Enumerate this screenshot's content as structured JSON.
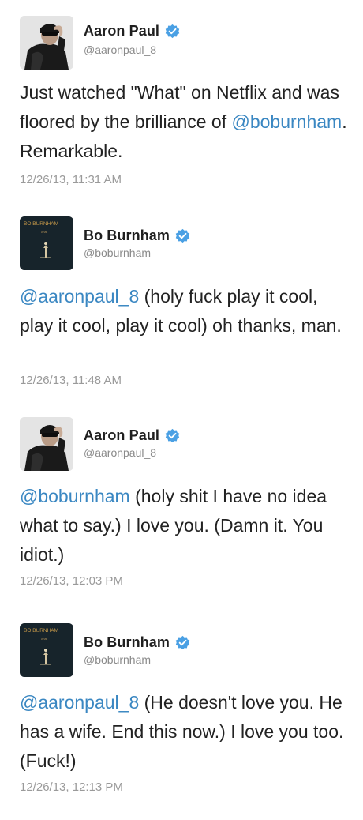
{
  "tweets": [
    {
      "author": "Aaron Paul",
      "handle": "@aaronpaul_8",
      "mention": "",
      "text_before": "Just watched \"What\" on Netflix and was floored by the brilliance of ",
      "inline_mention": "@boburnham",
      "text_after": ". Remarkable.",
      "timestamp": "12/26/13, 11:31 AM",
      "avatar_icon": "aaron-paul-photo-icon",
      "verified": true
    },
    {
      "author": "Bo Burnham",
      "handle": "@boburnham",
      "mention": "@aaronpaul_8",
      "text": " (holy fuck play it cool, play it cool, play it cool) oh thanks, man.",
      "timestamp": "12/26/13, 11:48 AM",
      "avatar_icon": "bo-burnham-album-icon",
      "avatar_caption": "BO BURNHAM",
      "verified": true
    },
    {
      "author": "Aaron Paul",
      "handle": "@aaronpaul_8",
      "mention": "@boburnham",
      "text": " (holy shit I have no idea what to say.) I love you. (Damn it. You idiot.)",
      "timestamp": "12/26/13, 12:03 PM",
      "avatar_icon": "aaron-paul-photo-icon",
      "verified": true
    },
    {
      "author": "Bo Burnham",
      "handle": "@boburnham",
      "mention": "@aaronpaul_8",
      "text": " (He doesn't love you. He has a wife. End this now.) I love you too. (Fuck!)",
      "timestamp": "12/26/13, 12:13 PM",
      "avatar_icon": "bo-burnham-album-icon",
      "avatar_caption": "BO BURNHAM",
      "verified": true
    }
  ],
  "colors": {
    "mention": "#3a87c2",
    "verified_badge": "#4aa0e4",
    "timestamp": "#9a9a9a"
  }
}
